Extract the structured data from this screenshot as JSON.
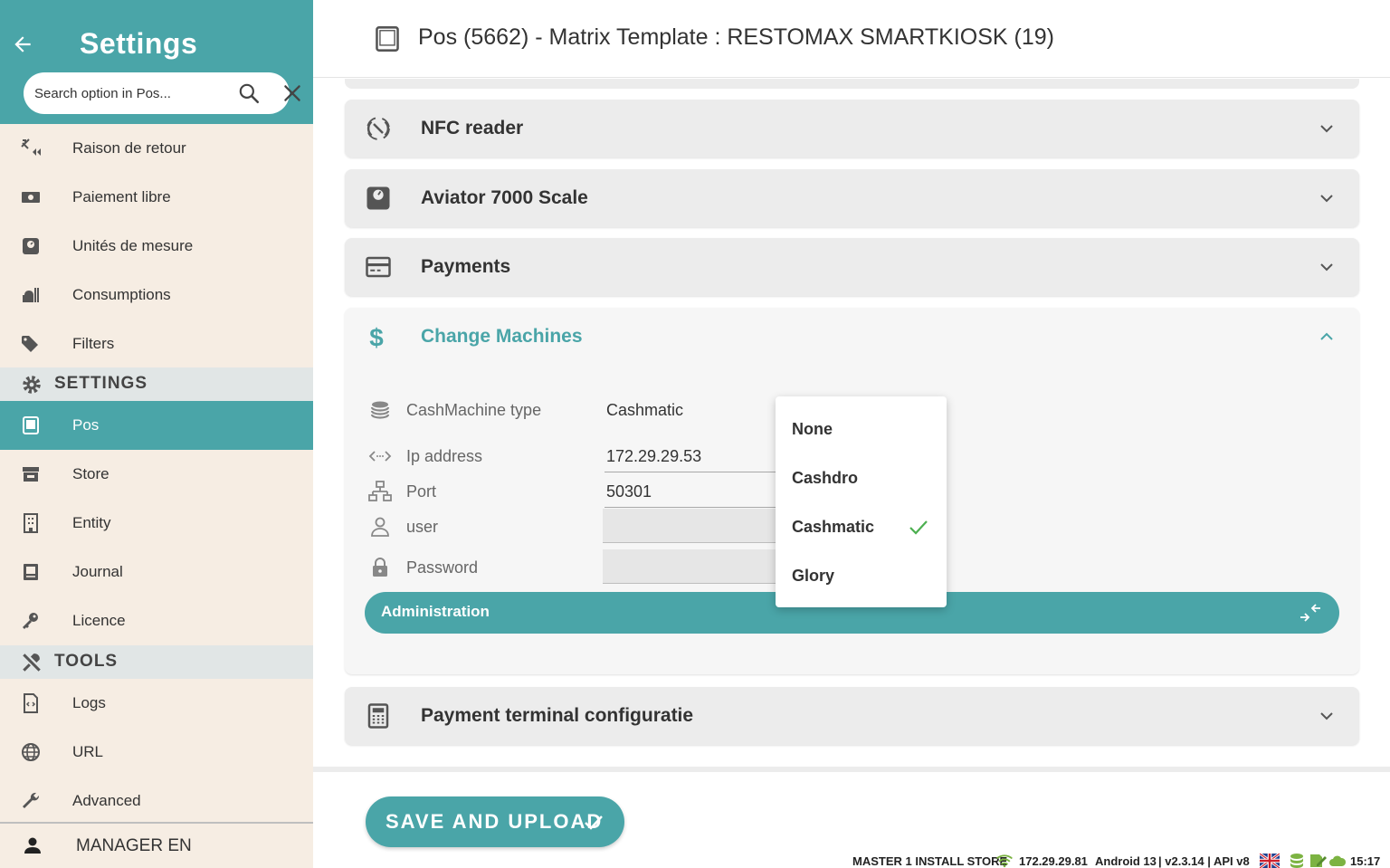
{
  "sidebar": {
    "title": "Settings",
    "search_placeholder": "Search option in Pos...",
    "items_top": [
      {
        "label": "Raison de retour",
        "icon": "return-reason-icon"
      },
      {
        "label": "Paiement libre",
        "icon": "cash-icon"
      },
      {
        "label": "Unités de mesure",
        "icon": "scale-icon"
      },
      {
        "label": "Consumptions",
        "icon": "consumption-icon"
      },
      {
        "label": "Filters",
        "icon": "tags-icon"
      }
    ],
    "section_settings": "SETTINGS",
    "items_settings": [
      {
        "label": "Pos",
        "icon": "tablet-icon",
        "active": true
      },
      {
        "label": "Store",
        "icon": "store-icon"
      },
      {
        "label": "Entity",
        "icon": "building-icon"
      },
      {
        "label": "Journal",
        "icon": "journal-icon"
      },
      {
        "label": "Licence",
        "icon": "key-icon"
      }
    ],
    "section_tools": "TOOLS",
    "items_tools": [
      {
        "label": "Logs",
        "icon": "log-file-icon"
      },
      {
        "label": "URL",
        "icon": "globe-icon"
      },
      {
        "label": "Advanced",
        "icon": "wrench-icon"
      }
    ],
    "user_label": "MANAGER EN"
  },
  "header": {
    "title": "Pos (5662) - Matrix Template : RESTOMAX SMARTKIOSK (19)"
  },
  "panels": {
    "nfc": "NFC reader",
    "scale": "Aviator 7000 Scale",
    "payments": "Payments",
    "change_machines": "Change Machines",
    "payment_terminal": "Payment terminal configuratie"
  },
  "change_machines": {
    "cash_machine_type_label": "CashMachine type",
    "cash_machine_type_value": "Cashmatic",
    "ip_label": "Ip address",
    "ip_value": "172.29.29.53",
    "port_label": "Port",
    "port_value": "50301",
    "user_label": "user",
    "user_value": "",
    "password_label": "Password",
    "password_value": "",
    "administration_label": "Administration"
  },
  "dropdown": {
    "options": [
      "None",
      "Cashdro",
      "Cashmatic",
      "Glory"
    ],
    "selected": "Cashmatic"
  },
  "footer": {
    "save_label": "SAVE AND UPLOAD",
    "store": "MASTER 1 INSTALL STORE",
    "ip": "172.29.29.81",
    "android": "Android 13",
    "version": "| v2.3.14 | API v8",
    "time": "15:17"
  },
  "colors": {
    "accent": "#4aa5a8",
    "sidebar_bg": "#f6ede3",
    "panel_bg": "#ececec",
    "check": "#4caf50"
  }
}
